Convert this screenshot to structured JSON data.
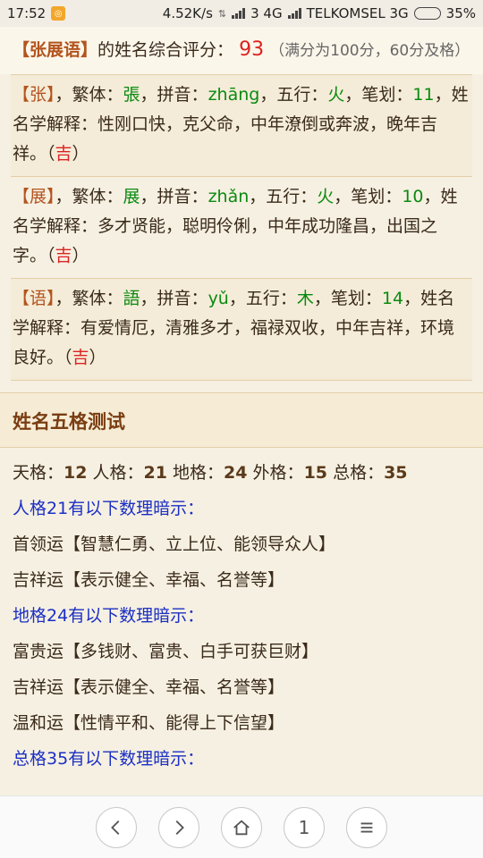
{
  "status_bar": {
    "time": "17:52",
    "speed": "4.52K/s",
    "network_label": "3 4G",
    "carrier": "TELKOMSEL 3G",
    "battery": "35%",
    "battery_level": 0.35
  },
  "score": {
    "name": "【张展语】",
    "text": "的姓名综合评分：",
    "value": "93",
    "note": "（满分为100分，60分及格）"
  },
  "characters": [
    {
      "char": "【张】",
      "trad_label": "，繁体：",
      "trad": "張",
      "pinyin_label": "，拼音：",
      "pinyin": "zhāng",
      "element_label": "，五行：",
      "element": "火",
      "strokes_label": "，笔划：",
      "strokes": "11",
      "meaning_label": "，姓名学解释：",
      "meaning": "性刚口快，克父命，中年潦倒或奔波，晚年吉祥。",
      "luck": "吉"
    },
    {
      "char": "【展】",
      "trad_label": "，繁体：",
      "trad": "展",
      "pinyin_label": "，拼音：",
      "pinyin": "zhǎn",
      "element_label": "，五行：",
      "element": "火",
      "strokes_label": "，笔划：",
      "strokes": "10",
      "meaning_label": "，姓名学解释：",
      "meaning": "多才贤能，聪明伶俐，中年成功隆昌，出国之字。",
      "luck": "吉"
    },
    {
      "char": "【语】",
      "trad_label": "，繁体：",
      "trad": "語",
      "pinyin_label": "，拼音：",
      "pinyin": "yǔ",
      "element_label": "，五行：",
      "element": "木",
      "strokes_label": "，笔划：",
      "strokes": "14",
      "meaning_label": "，姓名学解释：",
      "meaning": "有爱情厄，清雅多才，福禄双收，中年吉祥，环境良好。",
      "luck": "吉"
    }
  ],
  "wuge": {
    "title": "姓名五格测试",
    "tian_label": "天格：",
    "tian": "12",
    "ren_label": "人格：",
    "ren": "21",
    "di_label": "地格：",
    "di": "24",
    "wai_label": "外格：",
    "wai": "15",
    "zong_label": "总格：",
    "zong": "35",
    "ren_hint": "人格21有以下数理暗示：",
    "ren_items": [
      "首领运【智慧仁勇、立上位、能领导众人】",
      "吉祥运【表示健全、幸福、名誉等】"
    ],
    "di_hint": "地格24有以下数理暗示：",
    "di_items": [
      "富贵运【多钱财、富贵、白手可获巨财】",
      "吉祥运【表示健全、幸福、名誉等】",
      "温和运【性情平和、能得上下信望】"
    ],
    "zong_hint": "总格35有以下数理暗示："
  },
  "nav": {
    "page": "1"
  }
}
